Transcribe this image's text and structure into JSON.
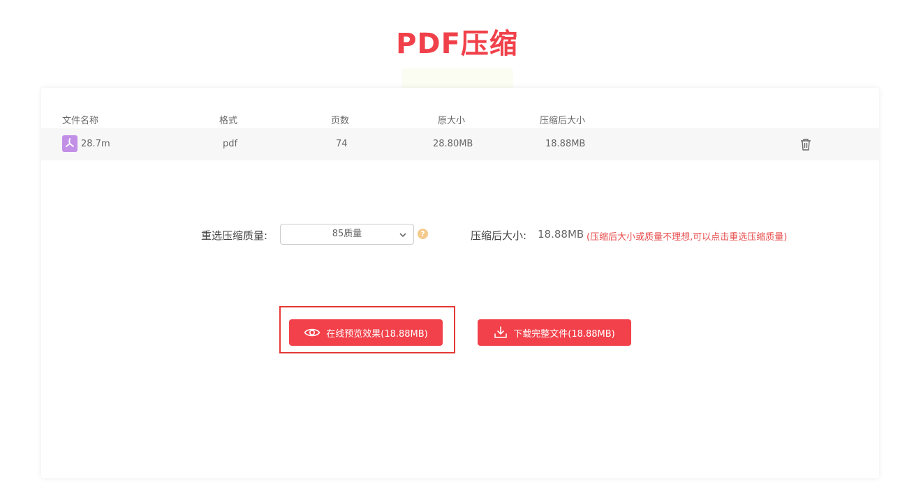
{
  "header": {
    "title": "PDF压缩"
  },
  "table": {
    "columns": [
      "文件名称",
      "格式",
      "页数",
      "原大小",
      "压缩后大小"
    ],
    "row": {
      "file_name": "28.7m",
      "format": "pdf",
      "pages": "74",
      "original_size": "28.80MB",
      "compressed_size": "18.88MB"
    }
  },
  "quality": {
    "label": "重选压缩质量:",
    "selected": "85质量",
    "help": "?"
  },
  "result": {
    "label": "压缩后大小:",
    "value": "18.88MB",
    "hint": "(压缩后大小或质量不理想,可以点击重选压缩质量)"
  },
  "actions": {
    "preview_label": "在线预览效果(18.88MB)",
    "download_label": "下载完整文件(18.88MB)"
  },
  "colors": {
    "brand": "#f0414a",
    "button": "#f2414a",
    "highlight_border": "#e53935",
    "hint_text": "#e84b4b",
    "pdf_icon": "#c28fe6"
  },
  "icons": [
    "pdf-file-icon",
    "trash-icon",
    "chevron-down-icon",
    "help-icon",
    "eye-icon",
    "download-icon"
  ]
}
